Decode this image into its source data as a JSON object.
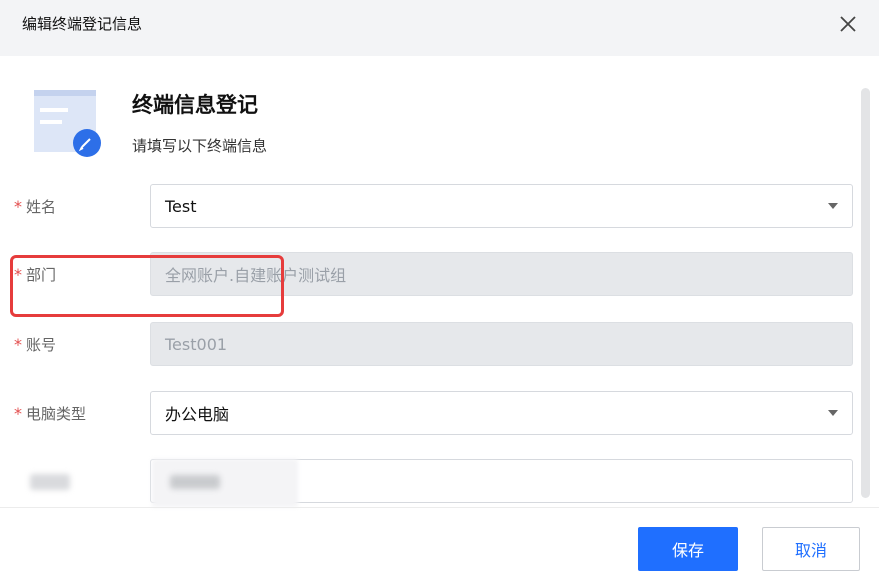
{
  "dialog": {
    "title": "编辑终端登记信息"
  },
  "form": {
    "heading": "终端信息登记",
    "subheading": "请填写以下终端信息",
    "required_mark": "*",
    "fields": [
      {
        "label": "姓名",
        "value": "Test",
        "type": "select"
      },
      {
        "label": "部门",
        "value": "全网账户.自建账户测试组",
        "type": "disabled"
      },
      {
        "label": "账号",
        "value": "Test001",
        "type": "disabled"
      },
      {
        "label": "电脑类型",
        "value": "办公电脑",
        "type": "select"
      }
    ]
  },
  "footer": {
    "save_label": "保存",
    "cancel_label": "取消"
  },
  "colors": {
    "primary": "#1f6fff",
    "required": "#e34d4d",
    "highlight": "#e63c3c"
  }
}
